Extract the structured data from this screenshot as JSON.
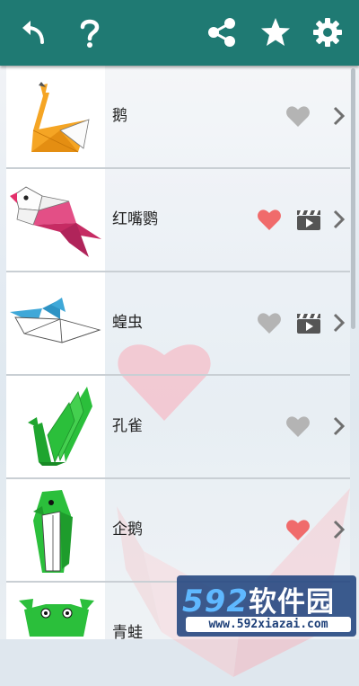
{
  "toolbar": {
    "icons": [
      "back-arrow-icon",
      "help-icon",
      "share-icon",
      "star-icon",
      "gear-icon"
    ],
    "color": "#1f7a73"
  },
  "items": [
    {
      "label": "鹅",
      "favorite": false,
      "has_video": false
    },
    {
      "label": "红嘴鹦",
      "favorite": true,
      "has_video": true
    },
    {
      "label": "蝗虫",
      "favorite": false,
      "has_video": true
    },
    {
      "label": "孔雀",
      "favorite": false,
      "has_video": false
    },
    {
      "label": "企鹅",
      "favorite": true,
      "has_video": false
    },
    {
      "label": "青蛙",
      "favorite": false,
      "has_video": false
    }
  ],
  "colors": {
    "heart_on": "#f06b6b",
    "heart_off": "#b4b4b4"
  },
  "watermark": {
    "logo_num": "592",
    "logo_cn": "软件园",
    "url": "www.592xiazai.com"
  }
}
